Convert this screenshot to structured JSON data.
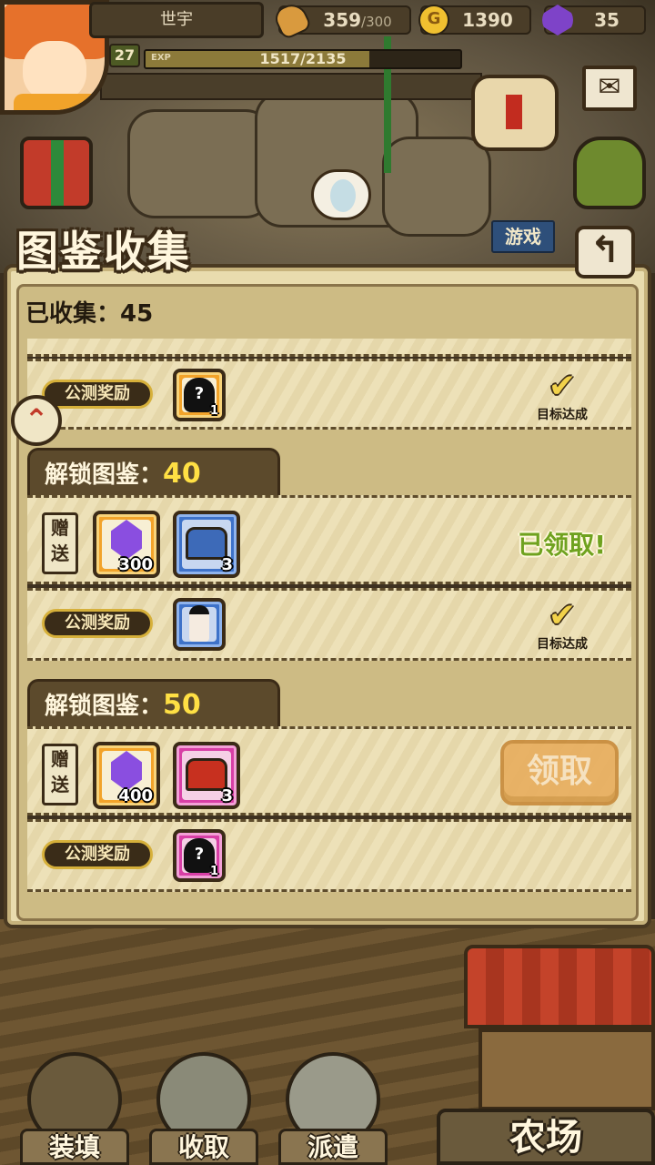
{
  "hud": {
    "player_name": "世宇",
    "level": "27",
    "exp_label": "EXP",
    "exp_value": "1517/2135",
    "exp_progress": 0.71,
    "bread": "359",
    "bread_cap": "/300",
    "coins": "1390",
    "coin_symbol": "G",
    "gems": "35"
  },
  "scene": {
    "game_sign": "游戏"
  },
  "panel": {
    "title": "图鉴收集",
    "back_glyph": "↰",
    "collected_label": "已收集：",
    "collected_value": "45"
  },
  "rows": {
    "top_partial": {
      "beta_label": "公测奖励",
      "reward_count": "1",
      "status": "目标达成"
    },
    "tier40": {
      "header_label": "解锁图鉴：",
      "header_value": "40",
      "gift_label": "赠送",
      "gem_count": "300",
      "chest_count": "3",
      "claimed_text": "已领取!",
      "beta_label": "公测奖励",
      "status": "目标达成"
    },
    "tier50": {
      "header_label": "解锁图鉴：",
      "header_value": "50",
      "gift_label": "赠送",
      "gem_count": "400",
      "chest_count": "3",
      "claim_button": "领取",
      "beta_label": "公测奖励",
      "reward_count": "1"
    }
  },
  "nav": {
    "load": "装填",
    "collect": "收取",
    "dispatch": "派遣",
    "farm": "农场"
  },
  "colors": {
    "accent_gold": "#ffe044",
    "claimed_green": "#6fa21f",
    "panel_bg": "#e9dcae"
  }
}
